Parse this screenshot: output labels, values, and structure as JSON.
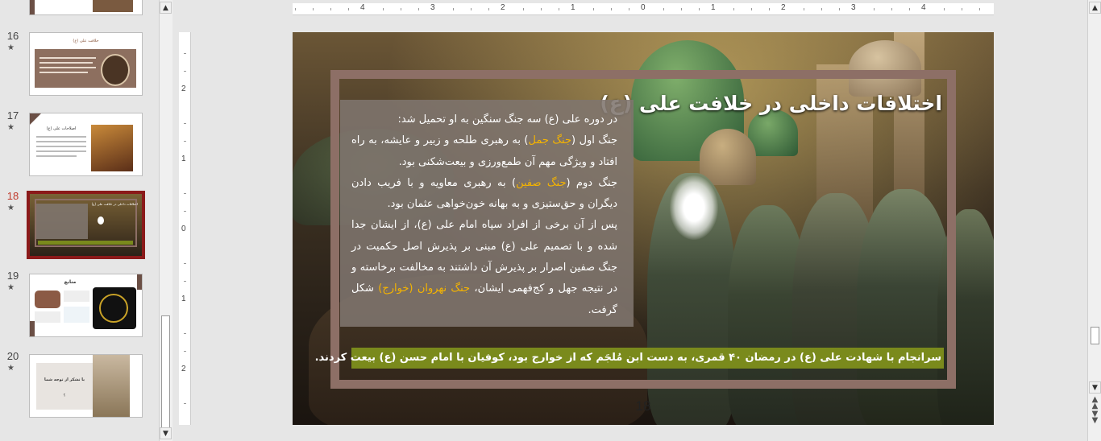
{
  "thumbnails": [
    {
      "number": "16",
      "title": "خلافت علی (ع)",
      "active": false
    },
    {
      "number": "17",
      "title": "اصلاحات علی (ع)",
      "active": false
    },
    {
      "number": "18",
      "title": "اختلافات داخلی در خلافت علی (ع)",
      "active": true
    },
    {
      "number": "19",
      "title": "منابع",
      "active": false
    },
    {
      "number": "20",
      "title": "با تشکر از توجه شما",
      "sub": "؟",
      "active": false
    }
  ],
  "ruler": {
    "horizontal": [
      "4",
      "3",
      "2",
      "1",
      "0",
      "1",
      "2",
      "3",
      "4"
    ],
    "vertical": [
      "2",
      "1",
      "0",
      "1",
      "2"
    ]
  },
  "slide": {
    "title": "اختلافات داخلی در خلافت علی (ع)",
    "lines": [
      {
        "parts": [
          {
            "t": "در دوره علی (ع) سه جنگ سنگین به او تحمیل شد:"
          }
        ]
      },
      {
        "parts": [
          {
            "t": "جنگ اول ("
          },
          {
            "t": "جنگ جمل",
            "hl": true
          },
          {
            "t": ") به رهبری طلحه و زبیر و عایشه، به راه افتاد و ویژگی مهم آن طمع‌ورزی و بیعت‌شکنی بود."
          }
        ]
      },
      {
        "parts": [
          {
            "t": "جنگ دوم ("
          },
          {
            "t": "جنگ صفین",
            "hl": true
          },
          {
            "t": ") به رهبری معاویه و با فریب دادن دیگران و حق‌ستیزی و به بهانه خون‌خواهی عثمان بود."
          }
        ]
      },
      {
        "parts": [
          {
            "t": "پس از آن برخی از افراد سپاه امام علی (ع)، از ایشان جدا شده و با تصمیم علی (ع) مبنی بر پذیرش اصل حکمیت در جنگ صفین اصرار بر پذیرش آن داشتند به مخالفت برخاسته و در نتیجه جهل و کج‌فهمی ایشان، "
          },
          {
            "t": "جنگ نهروان (خوارج)",
            "hl": true
          },
          {
            "t": " شکل گرفت."
          }
        ]
      }
    ],
    "bottom": "سرانجام با شهادت علی (ع) در رمضان ۴۰ قمری، به دست ابن مُلجَم که از خوارج بود، کوفیان با امام حسن (ع) بیعت کردند.",
    "page_number": "18"
  },
  "colors": {
    "accent": "#8b1a1a",
    "highlight": "#f5b400",
    "frame": "#8d6f66",
    "bottom_bar": "#7a8a1c"
  }
}
